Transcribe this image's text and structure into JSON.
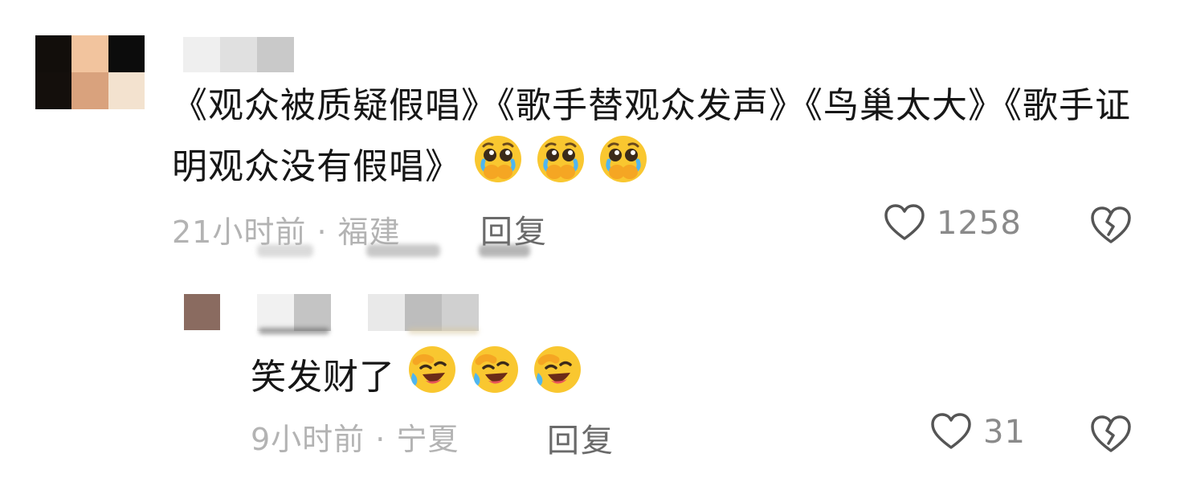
{
  "comment": {
    "text": "《观众被质疑假唱》《歌手替观众发声》《鸟巢太大》《歌手证明观众没有假唱》",
    "emojis": [
      "pleading-crying-emoji",
      "pleading-crying-emoji",
      "pleading-crying-emoji"
    ],
    "time": "21小时前",
    "location": "福建",
    "reply_label": "回复",
    "likes": "1258"
  },
  "reply": {
    "text": "笑发财了",
    "emojis": [
      "laughing-crying-emoji",
      "laughing-crying-emoji",
      "laughing-crying-emoji"
    ],
    "time": "9小时前",
    "location": "宁夏",
    "reply_label": "回复",
    "likes": "31"
  },
  "icons": {
    "like": "heart-outline-icon",
    "dislike": "broken-heart-icon"
  },
  "colors": {
    "text": "#161616",
    "meta": "#b3b3b3",
    "reply_button": "#6a6a6a",
    "like_count": "#8a8a8a",
    "icon_stroke": "#555555"
  }
}
